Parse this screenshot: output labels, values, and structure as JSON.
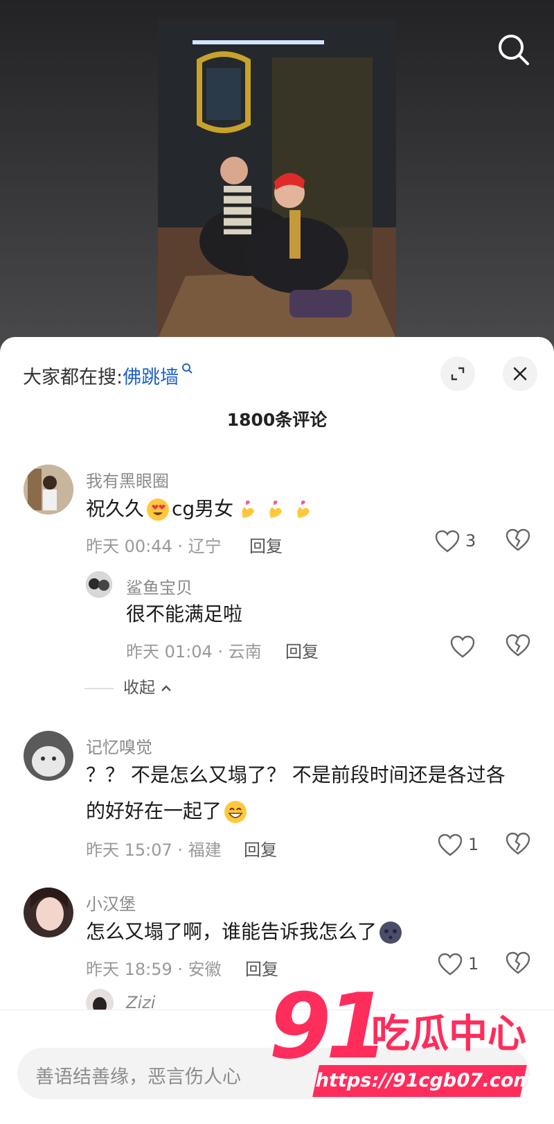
{
  "header": {
    "trending_prefix": "大家都在搜:",
    "trending_keyword": "佛跳墙",
    "comment_count": "1800条评论"
  },
  "comments": [
    {
      "username": "我有黑眼圈",
      "text": "祝久久",
      "text_tail": "cg男女",
      "time_location": "昨天 00:44 · 辽宁",
      "reply_label": "回复",
      "likes": "3"
    },
    {
      "username": "鲨鱼宝贝",
      "text": "很不能满足啦",
      "time_location": "昨天 01:04 · 云南",
      "reply_label": "回复",
      "likes": ""
    },
    {
      "username": "记忆嗅觉",
      "text": "？？ 不是怎么又塌了？ 不是前段时间还是各过各的好好在一起了",
      "time_location": "昨天 15:07 · 福建",
      "reply_label": "回复",
      "likes": "1"
    },
    {
      "username": "小汉堡",
      "text": "怎么又塌了啊，谁能告诉我怎么了",
      "time_location": "昨天 18:59 · 安徽",
      "reply_label": "回复",
      "likes": "1"
    },
    {
      "username": "Zizi"
    }
  ],
  "collapse_label": "收起",
  "input_placeholder": "善语结善缘，恶言伤人心",
  "watermark": {
    "number": "91",
    "name": "吃瓜中心",
    "url": "https://91cgb07.com"
  },
  "colors": {
    "keyword": "#1e62c7",
    "watermark": "#ff2d5c"
  }
}
